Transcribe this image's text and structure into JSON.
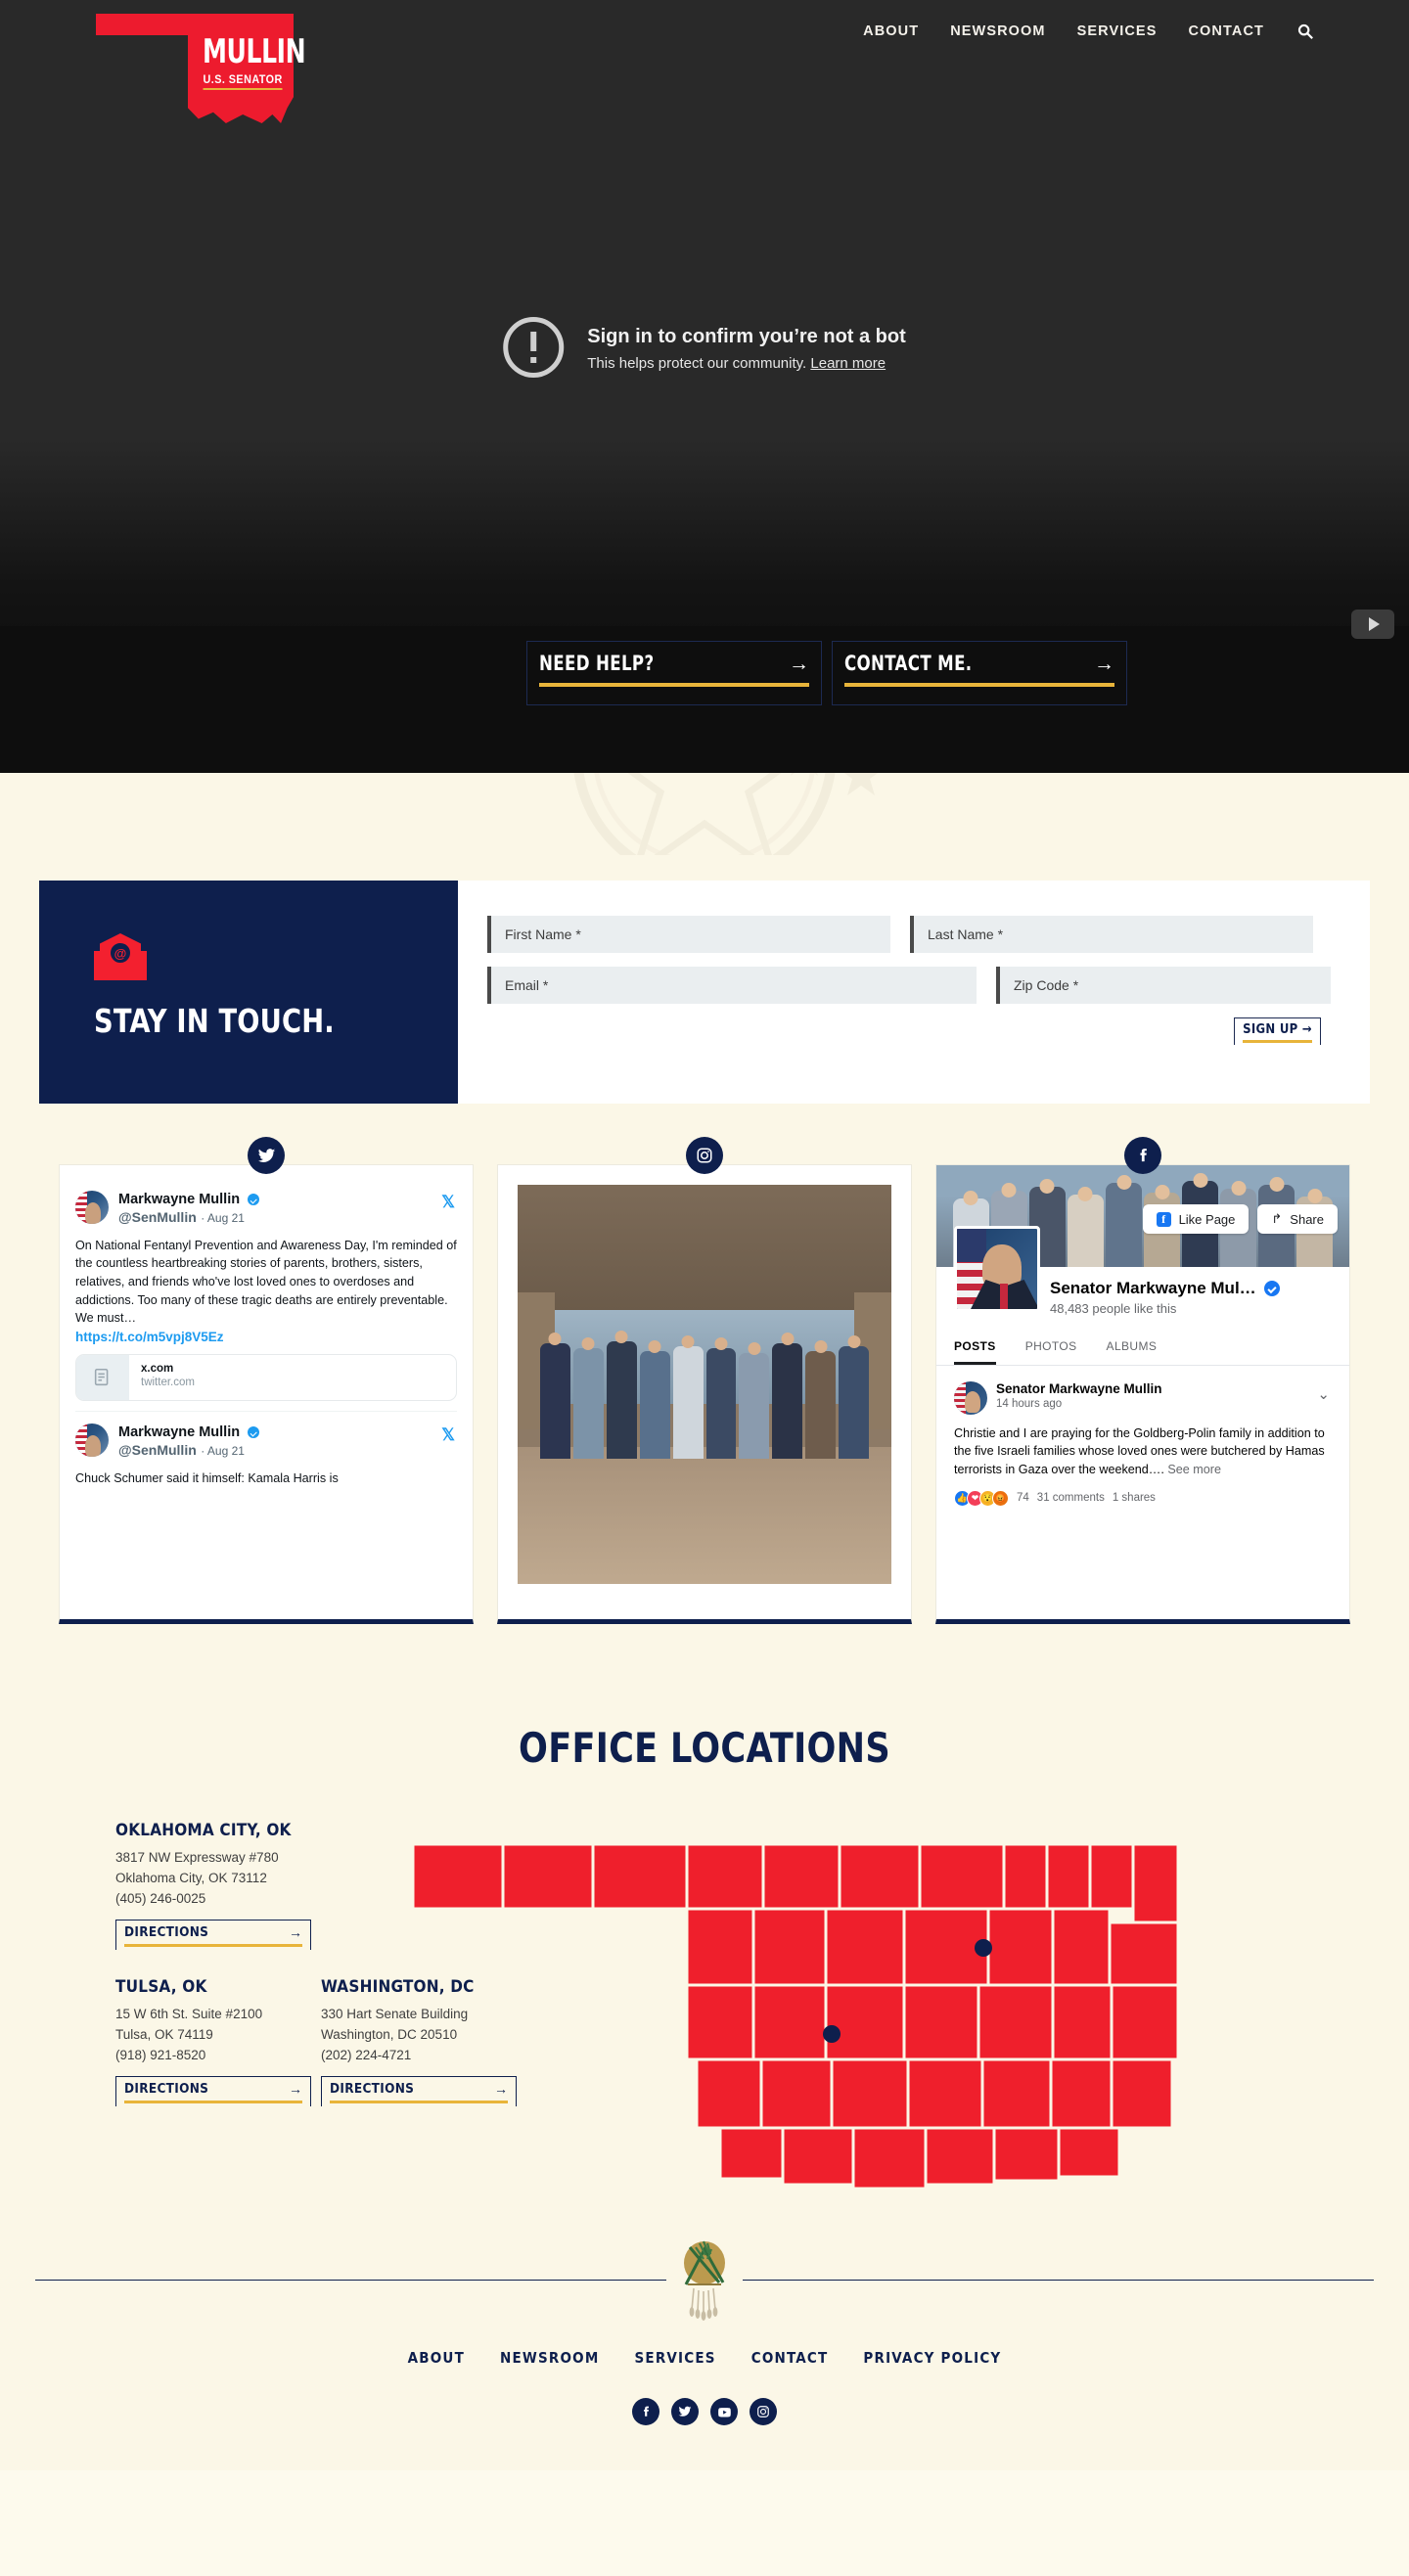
{
  "header": {
    "logo": {
      "main": "MULLIN",
      "sub": "U.S. SENATOR"
    },
    "nav": [
      {
        "label": "ABOUT"
      },
      {
        "label": "NEWSROOM"
      },
      {
        "label": "SERVICES"
      },
      {
        "label": "CONTACT"
      }
    ],
    "search_icon": "search-icon"
  },
  "hero": {
    "bot_title": "Sign in to confirm you’re not a bot",
    "bot_subtitle": "This helps protect our community.",
    "bot_learn_more": "Learn more",
    "youtube_badge": "youtube-play-icon",
    "cta": [
      {
        "label": "NEED HELP?",
        "arrow": "→"
      },
      {
        "label": "CONTACT ME.",
        "arrow": "→"
      }
    ]
  },
  "signup": {
    "title": "STAY IN TOUCH.",
    "icon": "email-envelope-icon",
    "fields": [
      {
        "name": "first-name",
        "placeholder": "First Name *"
      },
      {
        "name": "last-name",
        "placeholder": "Last Name *"
      },
      {
        "name": "email",
        "placeholder": "Email *"
      },
      {
        "name": "zip-code",
        "placeholder": "Zip Code *"
      }
    ],
    "submit_label": "SIGN UP →"
  },
  "social": {
    "twitter": {
      "badge": "twitter-icon",
      "tweets": [
        {
          "name": "Markwayne Mullin",
          "handle": "@SenMullin",
          "date": "· Aug 21",
          "text": "On National Fentanyl Prevention and Awareness Day, I'm reminded of the countless heartbreaking stories of parents, brothers, sisters, relatives, and friends who've lost loved ones to overdoses and addictions.    Too many of these tragic deaths are entirely preventable. We must…",
          "link": "https://t.co/m5vpj8V5Ez",
          "card_title": "x.com",
          "card_domain": "twitter.com"
        },
        {
          "name": "Markwayne Mullin",
          "handle": "@SenMullin",
          "date": "· Aug 21",
          "text": "Chuck Schumer said it himself: Kamala Harris is"
        }
      ]
    },
    "instagram": {
      "badge": "instagram-icon",
      "alt": "group photo of people standing indoors"
    },
    "facebook": {
      "badge": "facebook-icon",
      "like_button": "Like Page",
      "share_button": "Share",
      "page_name": "Senator Markwayne Mul…",
      "likes": "48,483 people like this",
      "tabs": [
        {
          "label": "POSTS",
          "active": true
        },
        {
          "label": "PHOTOS",
          "active": false
        },
        {
          "label": "ALBUMS",
          "active": false
        }
      ],
      "post": {
        "author": "Senator Markwayne Mullin",
        "time": "14 hours ago",
        "text": "Christie and I are praying for the Goldberg-Polin family in addition to the five Israeli families whose loved ones were butchered by Hamas terrorists in Gaza over the weekend….",
        "see_more": "See more",
        "reactions_count": "74",
        "comments": "31 comments",
        "shares": "1 shares"
      }
    }
  },
  "offices": {
    "title": "OFFICE LOCATIONS",
    "directions_label": "DIRECTIONS",
    "directions_arrow": "→",
    "items": [
      {
        "name": "OKLAHOMA CITY, OK",
        "address1": "3817 NW Expressway #780",
        "address2": "Oklahoma City, OK 73112",
        "phone": "(405) 246-0025"
      },
      {
        "name": "TULSA, OK",
        "address1": "15 W 6th St. Suite #2100",
        "address2": "Tulsa, OK 74119",
        "phone": "(918) 921-8520"
      },
      {
        "name": "WASHINGTON, DC",
        "address1": "330 Hart Senate Building",
        "address2": "Washington, DC 20510",
        "phone": "(202) 224-4721"
      }
    ],
    "map_alt": "Oklahoma county map with office markers"
  },
  "footer": {
    "seal": "oklahoma-state-seal-icon",
    "links": [
      {
        "label": "ABOUT"
      },
      {
        "label": "NEWSROOM"
      },
      {
        "label": "SERVICES"
      },
      {
        "label": "CONTACT"
      },
      {
        "label": "PRIVACY POLICY"
      }
    ],
    "social": [
      {
        "name": "facebook-icon"
      },
      {
        "name": "twitter-icon"
      },
      {
        "name": "youtube-icon"
      },
      {
        "name": "instagram-icon"
      }
    ]
  },
  "colors": {
    "red": "#ed1b2e",
    "navy": "#0e1f4d",
    "gold": "#e8b43a",
    "cream": "#fbf7e7",
    "dark": "#292929"
  }
}
